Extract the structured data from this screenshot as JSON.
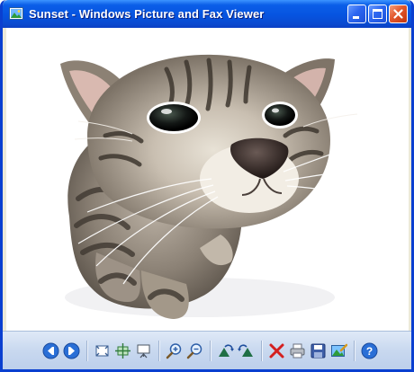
{
  "window": {
    "title": "Sunset - Windows Picture and Fax Viewer"
  },
  "title_buttons": [
    "minimize",
    "maximize",
    "close"
  ],
  "image": {
    "subject": "kitten",
    "background": "#ffffff"
  },
  "toolbar_icons": [
    "previous-image-icon",
    "next-image-icon",
    "best-fit-icon",
    "actual-size-icon",
    "slide-show-icon",
    "zoom-in-icon",
    "zoom-out-icon",
    "rotate-clockwise-icon",
    "rotate-counterclockwise-icon",
    "delete-icon",
    "print-icon",
    "copy-to-icon",
    "open-for-editing-icon",
    "help-icon"
  ],
  "colors": {
    "titlebar": "#0654e0",
    "window_border": "#0a3fd0",
    "close_button": "#e2572c",
    "toolbar": "#c8d8ef"
  }
}
